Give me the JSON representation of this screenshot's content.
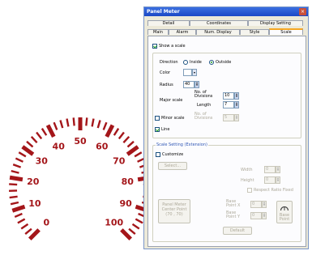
{
  "meter": {
    "color": "#a4161a",
    "tick_labels": [
      "0",
      "10",
      "20",
      "30",
      "40",
      "50",
      "60",
      "70",
      "80",
      "90",
      "100"
    ]
  },
  "dialog": {
    "title": "Panel Meter",
    "close_symbol": "×",
    "tabs_top": [
      "Detail",
      "Coordinates",
      "Display Setting"
    ],
    "tabs_bottom": [
      "Main",
      "Alarm",
      "Num. Display",
      "Style",
      "Scale"
    ],
    "active_tab": "Scale",
    "show_scale_label": "Show a scale",
    "show_scale_checked": true,
    "direction_label": "Direction",
    "direction_inside": "Inside",
    "direction_outside": "Outside",
    "direction_selected": "Outside",
    "color_label": "Color",
    "color_value": "#ffffff",
    "radius_label": "Radius",
    "radius_value": "40",
    "major_scale_label": "Major scale",
    "divisions_label": "No. of Divisions",
    "divisions_value": "10",
    "length_label": "Length",
    "length_value": "7",
    "minor_scale_label": "Minor scale",
    "minor_scale_checked": false,
    "minor_divisions_label": "No. of Divisions",
    "minor_divisions_value": "5",
    "line_label": "Line",
    "line_checked": true,
    "extension_title": "Scale Setting (Extension)",
    "customize_label": "Customize",
    "customize_checked": false,
    "select_button": "Select...",
    "width_label": "Width",
    "width_value": "0",
    "height_label": "Height",
    "height_value": "0",
    "respect_ratio_label": "Respect Ratio Fixed",
    "center_point_label": "Panel Meter Center Point",
    "center_point_value": "(70 , 70)",
    "base_point_x_label": "Base Point X",
    "base_point_x_value": "0",
    "base_point_y_label": "Base Point Y",
    "base_point_y_value": "0",
    "base_point_button_label": "Base Point",
    "default_button": "Default"
  }
}
